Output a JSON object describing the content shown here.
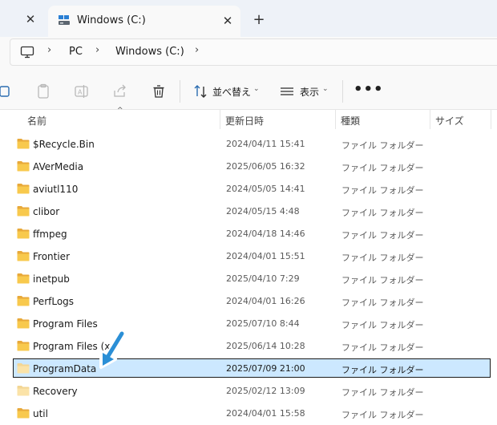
{
  "tabs": {
    "prev_close": "✕",
    "active": {
      "title": "Windows (C:)",
      "close": "✕"
    },
    "new_tab": "+"
  },
  "address": {
    "separator": "›",
    "crumbs": [
      "PC",
      "Windows (C:)"
    ],
    "icons": {
      "root": "computer-icon"
    }
  },
  "toolbar": {
    "sort_label": "並べ替え",
    "view_label": "表示",
    "caret": "⌄",
    "more": "•••",
    "icons": [
      "copy-icon",
      "paste-icon",
      "rename-icon",
      "share-icon",
      "delete-icon",
      "sort-icon",
      "view-icon",
      "more-icon"
    ]
  },
  "columns": {
    "name": "名前",
    "modified": "更新日時",
    "type": "種類",
    "size": "サイズ",
    "sort_caret": "^"
  },
  "files": [
    {
      "name": "$Recycle.Bin",
      "modified": "2024/04/11 15:41",
      "type": "ファイル フォルダー",
      "hidden": false
    },
    {
      "name": "AVerMedia",
      "modified": "2025/06/05 16:32",
      "type": "ファイル フォルダー",
      "hidden": false
    },
    {
      "name": "aviutl110",
      "modified": "2024/05/05 14:41",
      "type": "ファイル フォルダー",
      "hidden": false
    },
    {
      "name": "clibor",
      "modified": "2024/05/15 4:48",
      "type": "ファイル フォルダー",
      "hidden": false
    },
    {
      "name": "ffmpeg",
      "modified": "2024/04/18 14:46",
      "type": "ファイル フォルダー",
      "hidden": false
    },
    {
      "name": "Frontier",
      "modified": "2024/04/01 15:51",
      "type": "ファイル フォルダー",
      "hidden": false
    },
    {
      "name": "inetpub",
      "modified": "2025/04/10 7:29",
      "type": "ファイル フォルダー",
      "hidden": false
    },
    {
      "name": "PerfLogs",
      "modified": "2024/04/01 16:26",
      "type": "ファイル フォルダー",
      "hidden": false
    },
    {
      "name": "Program Files",
      "modified": "2025/07/10 8:44",
      "type": "ファイル フォルダー",
      "hidden": false
    },
    {
      "name": "Program Files (x",
      "modified": "2025/06/14 10:28",
      "type": "ファイル フォルダー",
      "hidden": false
    },
    {
      "name": "ProgramData",
      "modified": "2025/07/09 21:00",
      "type": "ファイル フォルダー",
      "hidden": true,
      "selected": true
    },
    {
      "name": "Recovery",
      "modified": "2025/02/12 13:09",
      "type": "ファイル フォルダー",
      "hidden": true
    },
    {
      "name": "util",
      "modified": "2024/04/01 15:58",
      "type": "ファイル フォルダー",
      "hidden": false
    }
  ],
  "colors": {
    "accent": "#2b8fd6",
    "selection": "#cce8ff",
    "folder": "#f8c94d",
    "folder_hidden": "#fbe3a8"
  }
}
